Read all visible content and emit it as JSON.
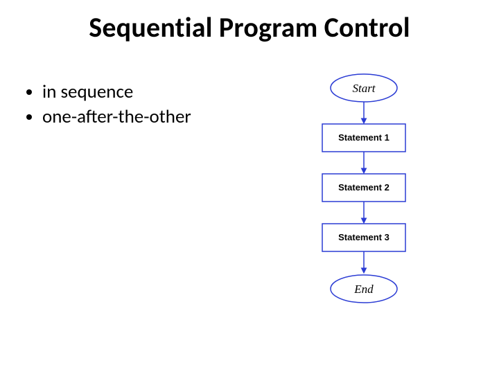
{
  "title": "Sequential Program Control",
  "bullets": [
    "in sequence",
    "one-after-the-other"
  ],
  "flowchart": {
    "start": "Start",
    "end": "End",
    "steps": [
      "Statement 1",
      "Statement 2",
      "Statement 3"
    ]
  },
  "colors": {
    "stroke": "#2a3bd4",
    "fill": "#ffffff"
  }
}
